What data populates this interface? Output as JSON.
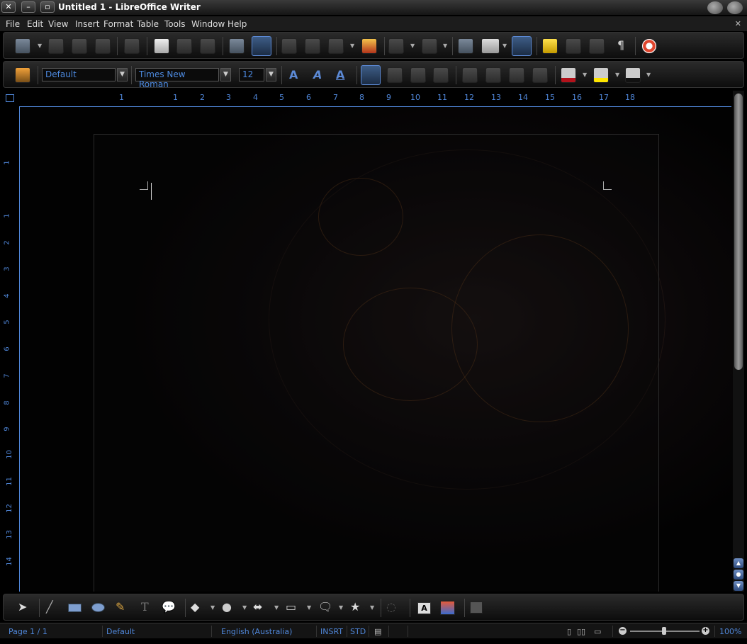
{
  "window": {
    "title": "Untitled 1 - LibreOffice Writer",
    "close_glyph": "✕",
    "minimize_glyph": "–",
    "maximize_glyph": "▫"
  },
  "menu": {
    "items": [
      "File",
      "Edit",
      "View",
      "Insert",
      "Format",
      "Table",
      "Tools",
      "Window",
      "Help"
    ],
    "close_glyph": "✕"
  },
  "standard_toolbar": {
    "icons": [
      "new-document-icon",
      "open-icon",
      "save-icon",
      "email-icon",
      "edit-file-icon",
      "export-pdf-icon",
      "print-icon",
      "print-preview-icon",
      "spellcheck-icon",
      "autospellcheck-icon",
      "cut-icon",
      "copy-icon",
      "paste-icon",
      "clone-formatting-icon",
      "undo-icon",
      "redo-icon",
      "hyperlink-icon",
      "table-icon",
      "show-draw-functions-icon",
      "navigator-icon",
      "gallery-icon",
      "data-sources-icon",
      "formatting-marks-icon",
      "help-icon"
    ],
    "pilcrow": "¶"
  },
  "formatting_toolbar": {
    "paragraph_style": "Default",
    "font_name": "Times New Roman",
    "font_size": "12",
    "bold_glyph": "A",
    "italic_glyph": "A",
    "underline_glyph": "A"
  },
  "ruler": {
    "horizontal_ticks": [
      "1",
      "1",
      "2",
      "3",
      "4",
      "5",
      "6",
      "7",
      "8",
      "9",
      "10",
      "11",
      "12",
      "13",
      "14",
      "15",
      "16",
      "17",
      "18"
    ],
    "vertical_ticks": [
      "1",
      "1",
      "2",
      "3",
      "4",
      "5",
      "6",
      "7",
      "8",
      "9",
      "10",
      "11",
      "12",
      "13",
      "14"
    ]
  },
  "drawing_toolbar": {
    "icons": [
      "select-icon",
      "line-icon",
      "rectangle-icon",
      "ellipse-icon",
      "freeform-icon",
      "text-icon",
      "callout-icon",
      "basic-shapes-icon",
      "symbol-shapes-icon",
      "block-arrows-icon",
      "flowchart-icon",
      "callouts-icon",
      "stars-icon",
      "points-icon",
      "fontwork-icon",
      "from-file-icon",
      "extrusion-icon"
    ]
  },
  "status": {
    "page": "Page 1 / 1",
    "page_style": "Default",
    "language": "English (Australia)",
    "insert_mode": "INSRT",
    "selection_mode": "STD",
    "zoom": "100%",
    "zoom_minus": "−",
    "zoom_plus": "+"
  },
  "scrollbar": {
    "up_glyph": "▲",
    "mid_glyph": "●",
    "down_glyph": "▼"
  }
}
